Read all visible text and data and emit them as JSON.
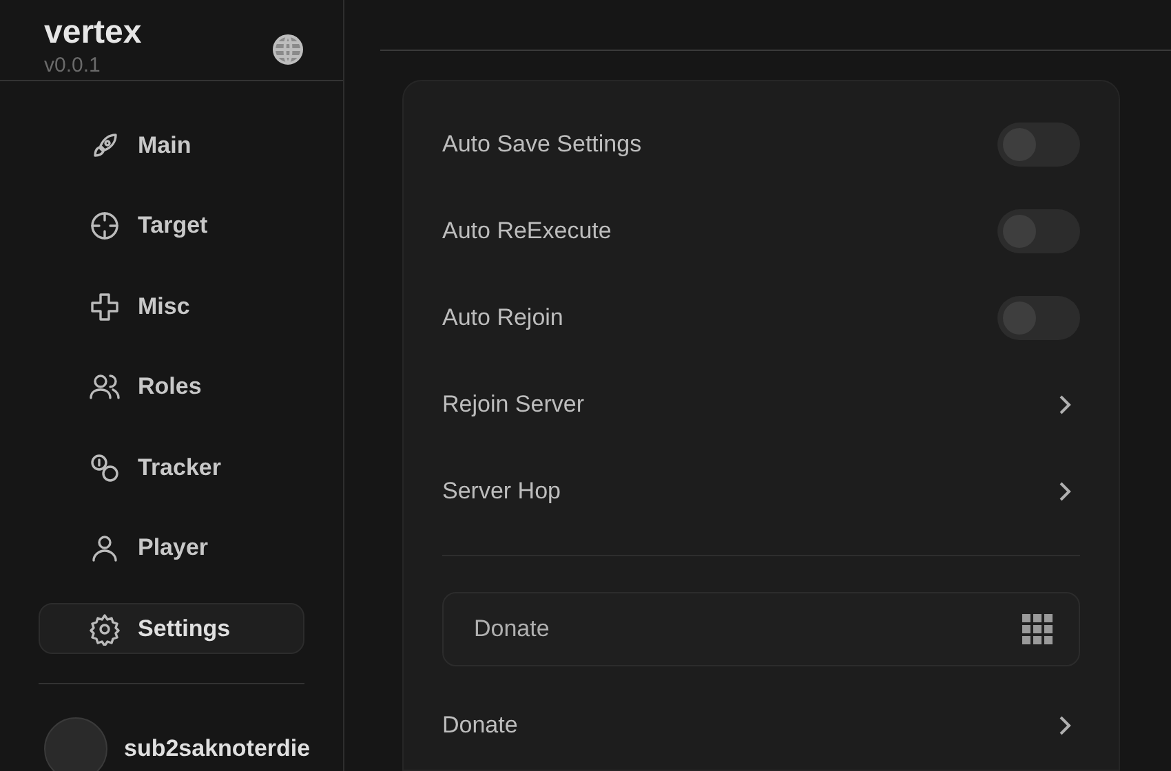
{
  "sidebar": {
    "title": "vertex",
    "version": "v0.0.1",
    "items": [
      {
        "label": "Main",
        "selected": false
      },
      {
        "label": "Target",
        "selected": false
      },
      {
        "label": "Misc",
        "selected": false
      },
      {
        "label": "Roles",
        "selected": false
      },
      {
        "label": "Tracker",
        "selected": false
      },
      {
        "label": "Player",
        "selected": false
      },
      {
        "label": "Settings",
        "selected": true
      }
    ],
    "user": {
      "name": "sub2saknoterdie"
    }
  },
  "settings": {
    "groups": [
      [
        {
          "kind": "toggle",
          "label": "Auto Save Settings",
          "on": false
        },
        {
          "kind": "toggle",
          "label": "Auto ReExecute",
          "on": false
        },
        {
          "kind": "toggle",
          "label": "Auto Rejoin",
          "on": false
        },
        {
          "kind": "button",
          "label": "Rejoin Server"
        },
        {
          "kind": "button",
          "label": "Server Hop"
        }
      ],
      [
        {
          "kind": "input",
          "placeholder": "Donate"
        },
        {
          "kind": "button",
          "label": "Donate"
        }
      ]
    ]
  }
}
